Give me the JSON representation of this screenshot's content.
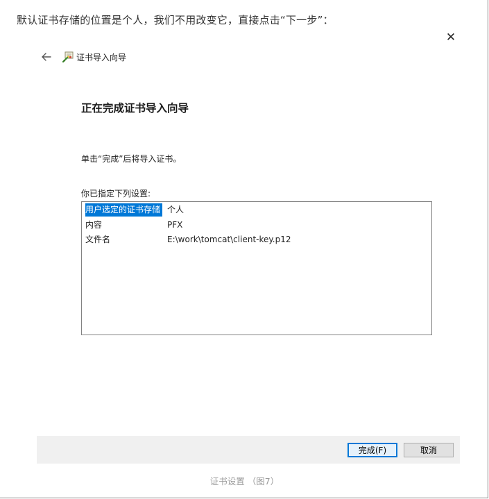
{
  "intro_text": "默认证书存储的位置是个人，我们不用改变它，直接点击“下一步”：",
  "dialog": {
    "close_symbol": "✕",
    "back_icon": "back-arrow-icon",
    "wizard_icon": "certificate-wizard-icon",
    "wizard_title": "证书导入向导",
    "heading": "正在完成证书导入向导",
    "instruction": "单击“完成”后将导入证书。",
    "settings_label": "你已指定下列设置:",
    "settings": [
      {
        "key": "用户选定的证书存储",
        "value": "个人"
      },
      {
        "key": "内容",
        "value": "PFX"
      },
      {
        "key": "文件名",
        "value": "E:\\work\\tomcat\\client-key.p12"
      }
    ],
    "finish_button": "完成(F)",
    "cancel_button": "取消"
  },
  "caption": "证书设置 （图7）",
  "colors": {
    "selection": "#0078d7",
    "footer_bg": "#f0f0f0",
    "caption": "#9a9a9a"
  }
}
